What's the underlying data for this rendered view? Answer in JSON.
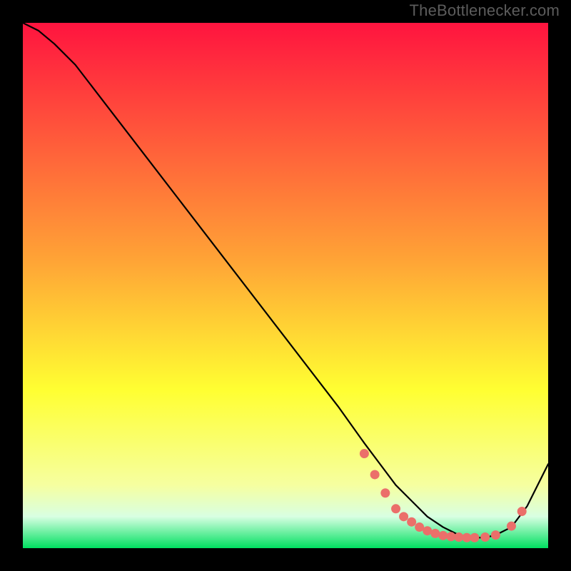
{
  "watermark": "TheBottlenecker.com",
  "chart_data": {
    "type": "line",
    "title": "",
    "xlabel": "",
    "ylabel": "",
    "xlim": [
      0,
      100
    ],
    "ylim": [
      0,
      100
    ],
    "grid": false,
    "gradient": {
      "top": "#ff143f",
      "mid_upper": "#ffa336",
      "mid": "#ffff32",
      "mid_lower": "#f6ffa0",
      "low": "#d8ffe2",
      "bottom": "#00e060"
    },
    "series": [
      {
        "name": "bottleneck-curve",
        "x": [
          0,
          3,
          6,
          10,
          20,
          30,
          40,
          50,
          60,
          65,
          68,
          71,
          74,
          77,
          80,
          83,
          86,
          88,
          90,
          93,
          96,
          100
        ],
        "y": [
          100,
          98.5,
          96,
          92,
          79,
          66,
          53,
          40,
          27,
          20,
          16,
          12,
          9,
          6,
          4,
          2.5,
          2,
          2,
          2.5,
          4,
          8,
          16
        ]
      }
    ],
    "markers": {
      "name": "flat-region-dots",
      "color": "#eb6f6a",
      "x": [
        65,
        67,
        69,
        71,
        72.5,
        74,
        75.5,
        77,
        78.5,
        80,
        81.5,
        83,
        84.5,
        86,
        88,
        90,
        93,
        95
      ],
      "y": [
        18,
        14,
        10.5,
        7.5,
        6,
        5,
        4,
        3.3,
        2.8,
        2.4,
        2.2,
        2.1,
        2.0,
        2.0,
        2.1,
        2.5,
        4.2,
        7
      ]
    }
  }
}
